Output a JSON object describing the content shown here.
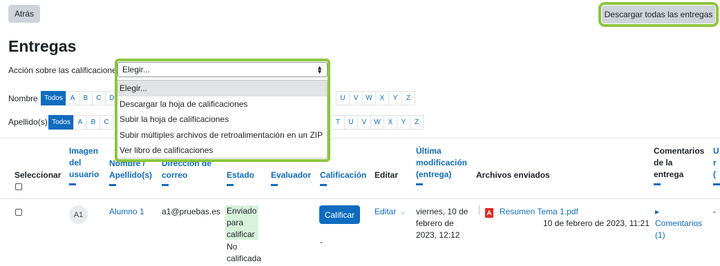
{
  "buttons": {
    "back": "Atrás",
    "download_all": "Descargar todas las entregas"
  },
  "page_title": "Entregas",
  "grading_action": {
    "label": "Acción sobre las calificaciones",
    "selected": "Elegir...",
    "options": [
      "Elegir...",
      "Descargar la hoja de calificaciones",
      "Subir la hoja de calificaciones",
      "Subir múltiples archivos de retroalimentación en un ZIP",
      "Ver libro de calificaciones"
    ]
  },
  "filters": {
    "nombre_label": "Nombre",
    "apellido_label": "Apellido(s)",
    "all": "Todos",
    "nombre_letters_left": [
      "A",
      "B",
      "C",
      "D"
    ],
    "nombre_letters_right": [
      "U",
      "V",
      "W",
      "X",
      "Y",
      "Z"
    ],
    "apellido_letters_left": [
      "A",
      "B",
      "C"
    ],
    "apellido_letters_right": [
      "T",
      "U",
      "V",
      "W",
      "X",
      "Y",
      "Z"
    ]
  },
  "table": {
    "headers": {
      "select": "Seleccionar",
      "image": [
        "Imagen",
        "del",
        "usuario"
      ],
      "name": [
        "Nombre /",
        "Apellido(s)"
      ],
      "email": [
        "Dirección de",
        "correo"
      ],
      "status": "Estado",
      "grader": "Evaluador",
      "grade": "Calificación",
      "edit": "Editar",
      "last_modified": [
        "Última",
        "modificación",
        "(entrega)"
      ],
      "files": "Archivos enviados",
      "comments": [
        "Comentarios",
        "de la",
        "entrega"
      ],
      "extra_top": "U",
      "extra_mid": "r",
      "extra_bot": "("
    },
    "rows": [
      {
        "initials": "A1",
        "name": "Alumno 1",
        "email": "a1@pruebas.es",
        "status_lines": [
          "Enviado",
          "para",
          "calificar"
        ],
        "grade_status_lines": [
          "No",
          "calificada"
        ],
        "grade_button": "Calificar",
        "grade_value": "-",
        "edit_label": "Editar",
        "modified_lines": [
          "viernes, 10 de",
          "febrero de",
          "2023, 12:12"
        ],
        "file_name": "Resumen Tema 1.pdf",
        "file_date": "10 de febrero de 2023, 11:21",
        "comments_lines": [
          "Comentarios",
          "(1)"
        ],
        "extra": "-"
      }
    ]
  },
  "colors": {
    "accent": "#0f6cbf",
    "highlight": "#8cc63f",
    "status_bg": "#d7f3dc"
  }
}
